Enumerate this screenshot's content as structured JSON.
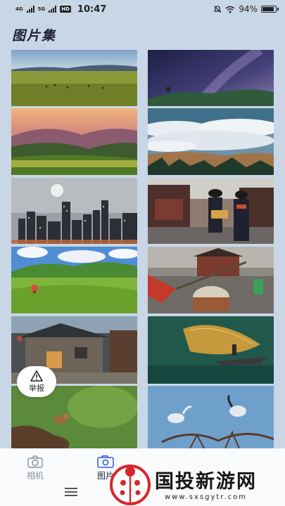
{
  "status_bar": {
    "net1": "4G",
    "net2": "5G",
    "hd": "HD",
    "time": "10:47",
    "battery_text": "94%",
    "battery_level": 0.94
  },
  "app": {
    "title": "图片集"
  },
  "gallery": {
    "images": [
      {
        "subject": "grassland-horses"
      },
      {
        "subject": "starry-night-hill"
      },
      {
        "subject": "sunset-valley"
      },
      {
        "subject": "sea-of-clouds"
      },
      {
        "subject": "city-night-moon"
      },
      {
        "subject": "costumed-couple-street"
      },
      {
        "subject": "green-hills-balloon"
      },
      {
        "subject": "drum-performance"
      },
      {
        "subject": "stone-house-ruins"
      },
      {
        "subject": "fisherman-net"
      },
      {
        "subject": "birds-on-log"
      },
      {
        "subject": "herons-on-branches"
      }
    ]
  },
  "report_button": {
    "label": "举报",
    "icon": "warning-triangle-icon"
  },
  "tabs": [
    {
      "label": "相机",
      "icon": "camera-icon",
      "active": false
    },
    {
      "label": "图片",
      "icon": "gallery-icon",
      "active": true
    }
  ],
  "watermark": {
    "text": "国投新游网",
    "url": "www.sxsgytr.com"
  }
}
